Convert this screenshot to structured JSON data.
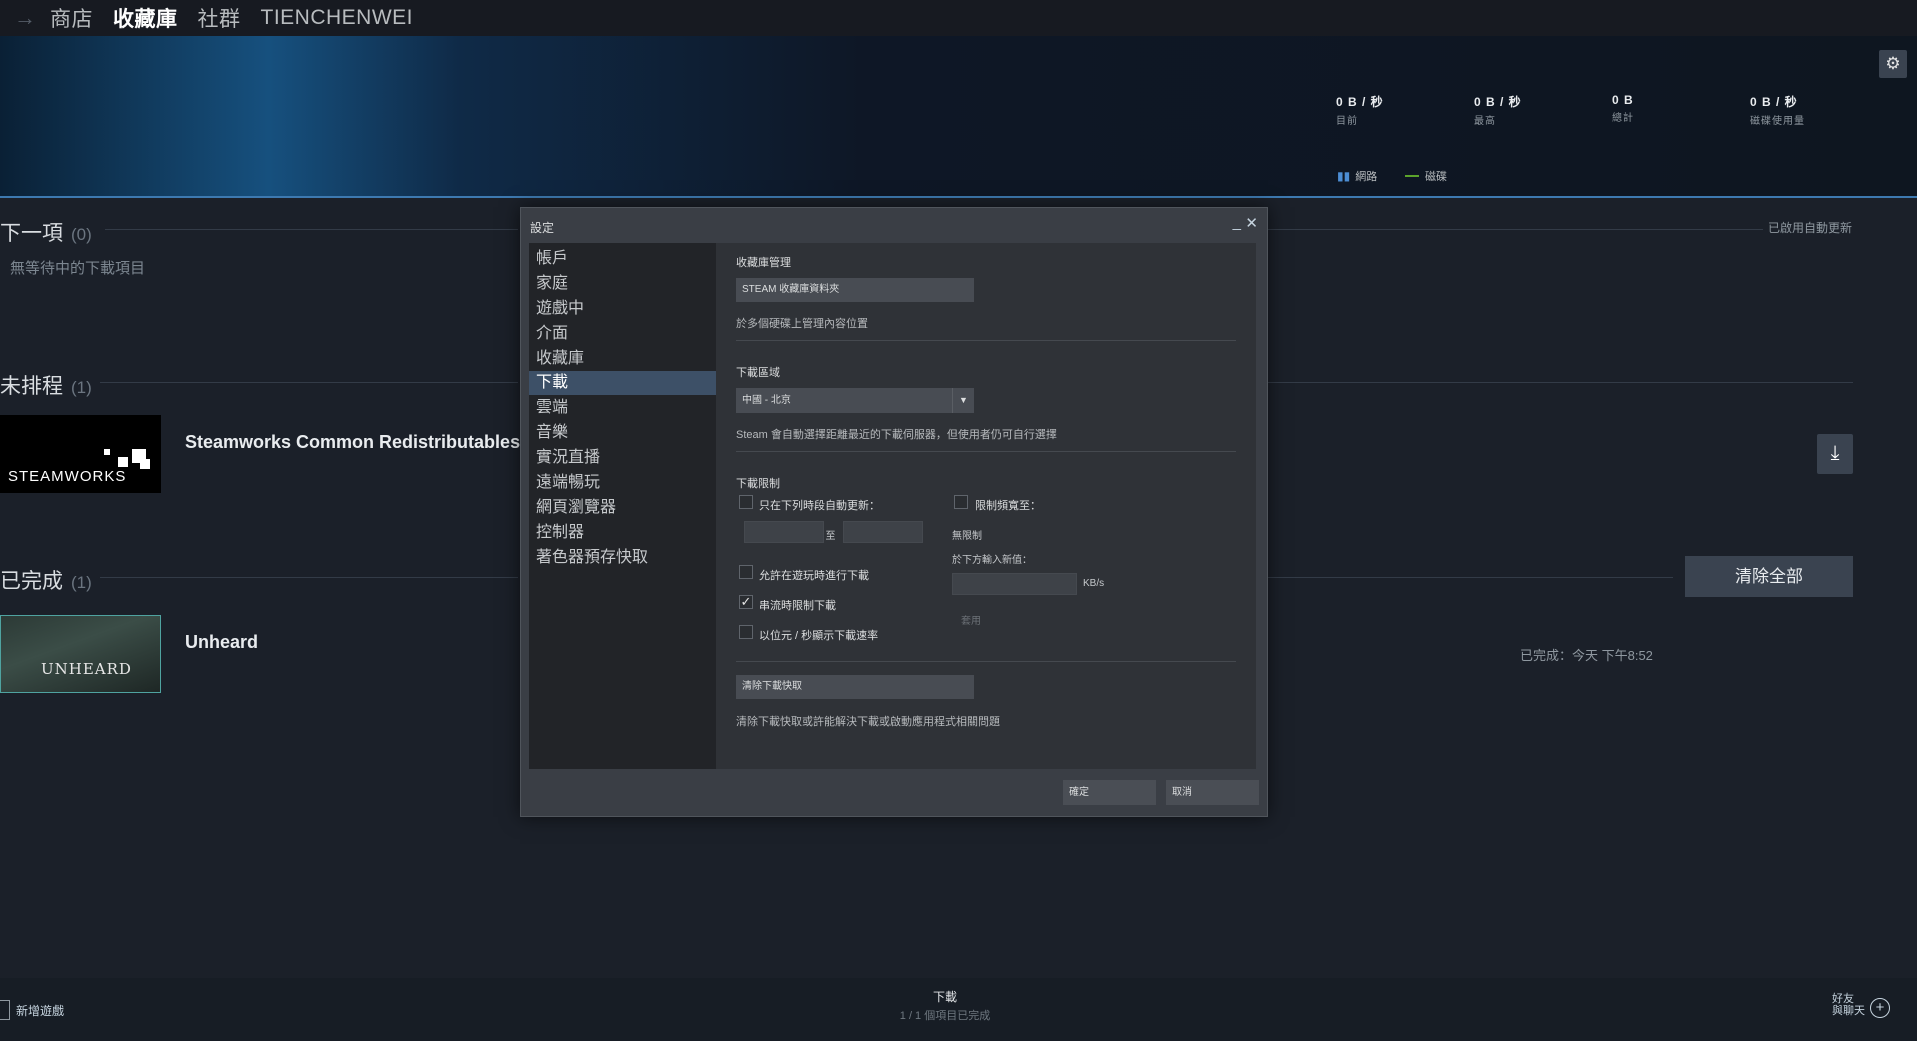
{
  "nav": {
    "back": "→",
    "items": [
      "商店",
      "收藏庫",
      "社群",
      "TIENCHENWEI"
    ]
  },
  "banner": {
    "gear_icon": "gear-icon",
    "stats": [
      {
        "value": "0 B / 秒",
        "label": "目前"
      },
      {
        "value": "0 B / 秒",
        "label": "最高"
      },
      {
        "value": "0 B",
        "label": "總計"
      },
      {
        "value": "0 B / 秒",
        "label": "磁碟使用量"
      }
    ],
    "legend": {
      "network": "網路",
      "disk": "磁碟"
    },
    "colors": {
      "network": "#4c8dd3",
      "disk": "#5ba32b"
    }
  },
  "sections": {
    "next": {
      "title": "下一項",
      "count": "(0)",
      "empty": "無等待中的下載項目",
      "auto_update": "已啟用自動更新"
    },
    "unscheduled": {
      "title": "未排程",
      "count": "(1)",
      "game": "Steamworks Common Redistributables",
      "thumb_text": "STEAMWORKS"
    },
    "completed": {
      "title": "已完成",
      "count": "(1)",
      "game": "Unheard",
      "thumb_text": "UNHEARD",
      "clear_all": "清除全部",
      "completed_time": "已完成：今天 下午8:52"
    }
  },
  "bottom": {
    "add_game": "新增遊戲",
    "downloads": "下載",
    "downloads_status": "1 / 1 個項目已完成",
    "friends_line1": "好友",
    "friends_line2": "與聊天",
    "friends_plus": "+"
  },
  "dialog": {
    "title": "設定",
    "minimize": "_",
    "close": "✕",
    "sidebar": [
      "帳戶",
      "家庭",
      "遊戲中",
      "介面",
      "收藏庫",
      "下載",
      "雲端",
      "音樂",
      "實況直播",
      "遠端暢玩",
      "網頁瀏覽器",
      "控制器",
      "著色器預存快取"
    ],
    "active_index": 5,
    "library": {
      "heading": "收藏庫管理",
      "button": "STEAM 收藏庫資料夾",
      "note": "於多個硬碟上管理內容位置"
    },
    "region": {
      "heading": "下載區域",
      "selected": "中國 - 北京",
      "note": "Steam 會自動選擇距離最近的下載伺服器，但使用者仍可自行選擇"
    },
    "limits": {
      "heading": "下載限制",
      "only_times": "只在下列時段自動更新：",
      "to": "至",
      "allow_while_playing": "允許在遊玩時進行下載",
      "throttle_streaming": "串流時限制下載",
      "show_bits": "以位元 / 秒顯示下載速率",
      "limit_bandwidth": "限制頻寬至：",
      "unlimited": "無限制",
      "enter_new": "於下方輸入新值：",
      "unit": "KB/s",
      "apply": "套用"
    },
    "cache": {
      "button": "清除下載快取",
      "note": "清除下載快取或許能解決下載或啟動應用程式相關問題"
    },
    "ok": "確定",
    "cancel": "取消"
  }
}
